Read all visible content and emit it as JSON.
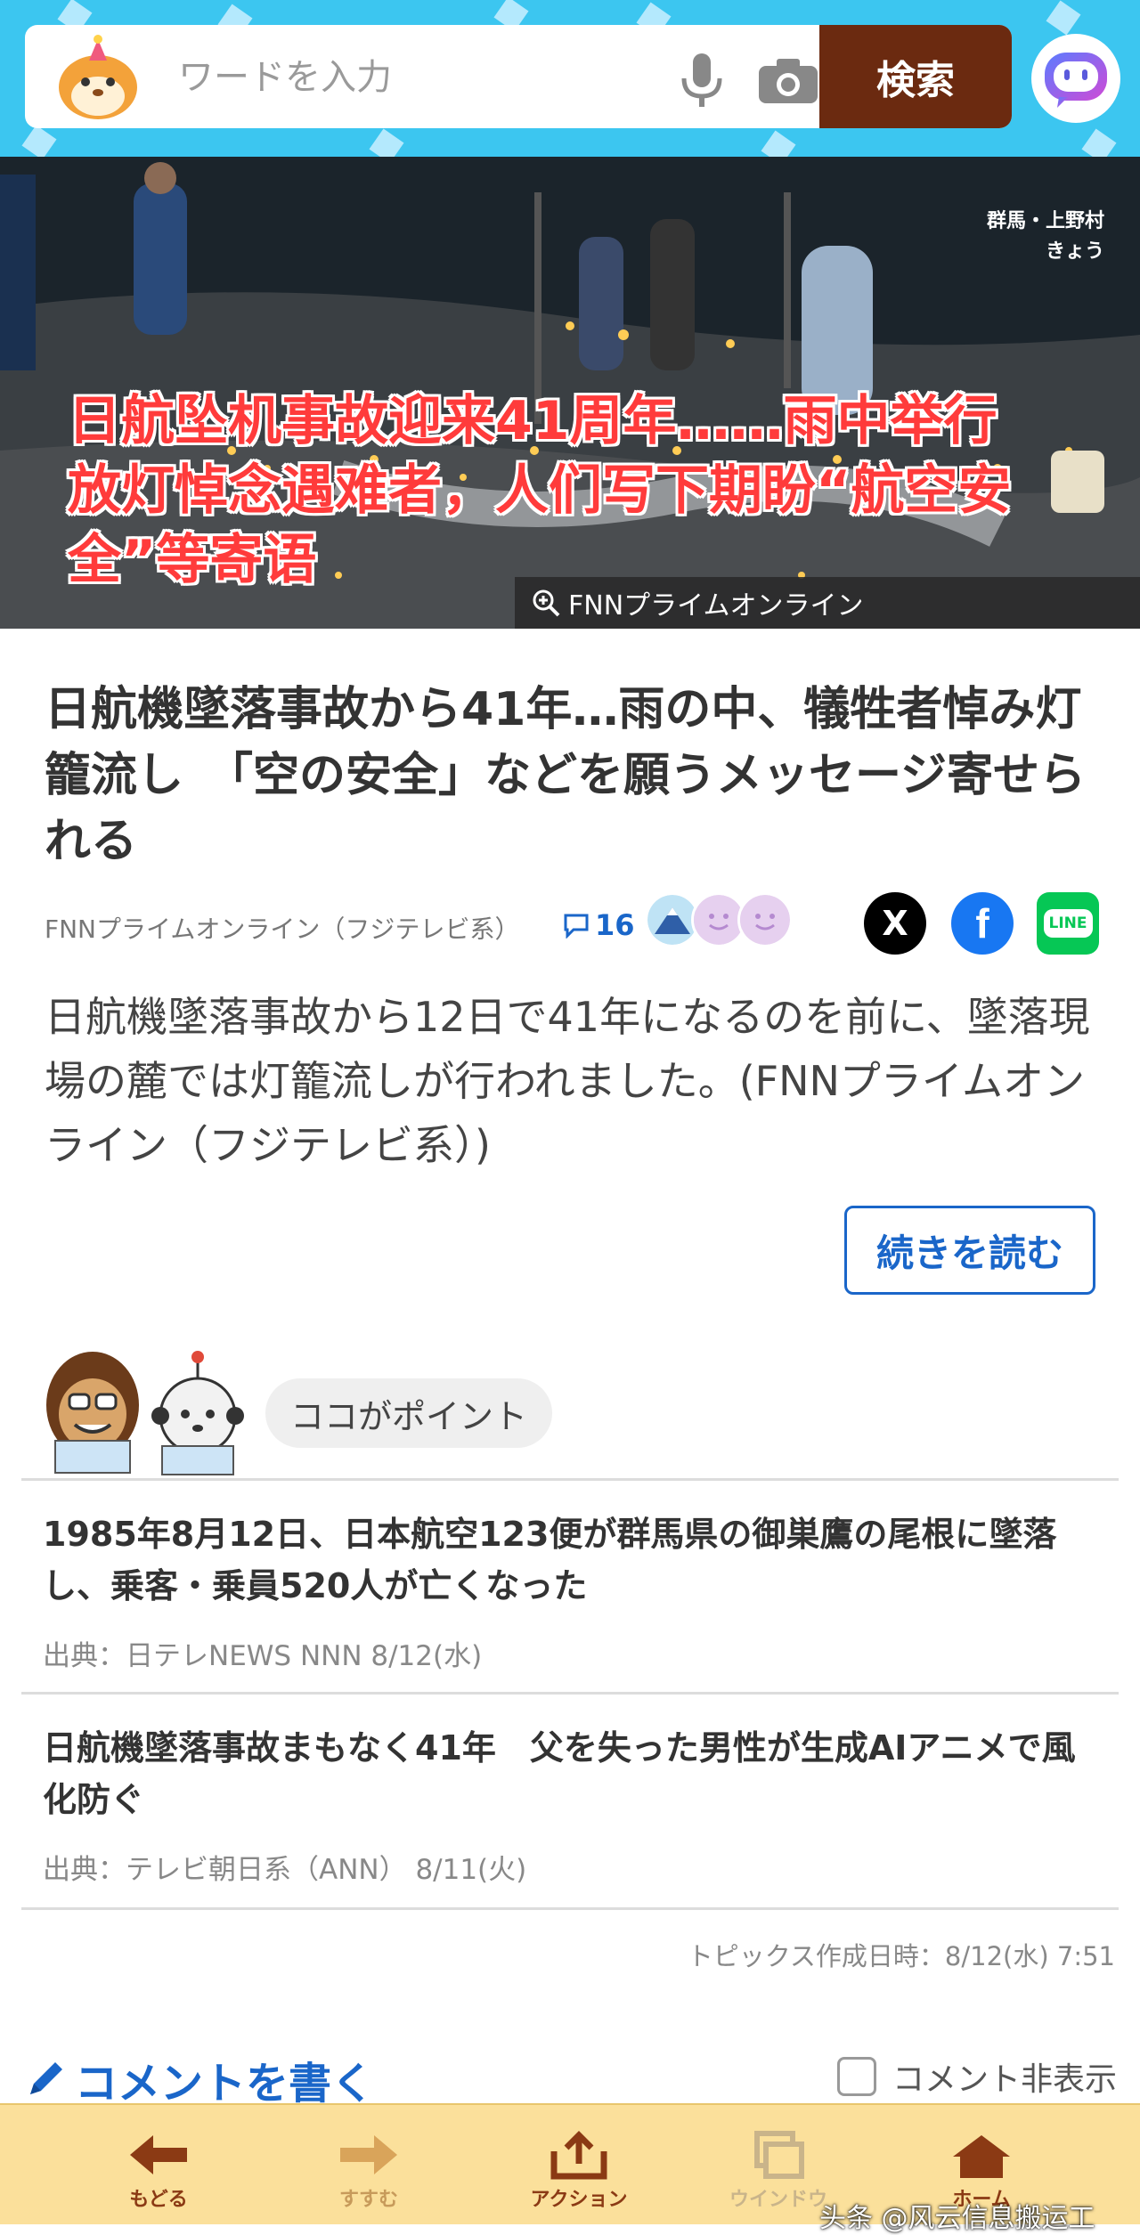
{
  "search": {
    "placeholder": "ワードを入力",
    "button_label": "検索"
  },
  "hero": {
    "location_line1": "群馬・上野村",
    "location_line2": "きょう",
    "caption": "日航坠机事故迎来41周年……雨中举行放灯悼念遇难者，人们写下期盼“航空安全”等寄语",
    "credit": "FNNプライムオンライン"
  },
  "article": {
    "title": "日航機墜落事故から41年…雨の中、犠牲者悼み灯籠流し　「空の安全」などを願うメッセージ寄せられる",
    "source": "FNNプライムオンライン（フジテレビ系）",
    "comment_count": "16",
    "share_x": "X",
    "share_facebook": "f",
    "share_line": "LINE",
    "summary": "日航機墜落事故から12日で41年になるのを前に、墜落現場の麓では灯籠流しが行われました。(FNNプライムオンライン（フジテレビ系）)",
    "read_more": "続きを読む"
  },
  "points": {
    "badge": "ココがポイント",
    "items": [
      {
        "headline": "1985年8月12日、日本航空123便が群馬県の御巣鷹の尾根に墜落し、乗客・乗員520人が亡くなった",
        "source": "出典：日テレNEWS NNN 8/12(水)"
      },
      {
        "headline": "日航機墜落事故まもなく41年　父を失った男性が生成AIアニメで風化防ぐ",
        "source": "出典：テレビ朝日系（ANN） 8/11(火)"
      }
    ],
    "topic_time": "トピックス作成日時：8/12(水) 7:51"
  },
  "comment_row": {
    "write": "コメントを書く",
    "hide": "コメント非表示"
  },
  "bottom_nav": {
    "back": "もどる",
    "forward": "すすむ",
    "action": "アクション",
    "window": "ウインドウ",
    "home": "ホーム"
  },
  "watermark": "头条 @风云信息搬运工",
  "colors": {
    "header_bg": "#3cc6f0",
    "search_button": "#6b2a10",
    "link_blue": "#1a66c9",
    "caption_red": "#ff3b3b",
    "bottom_bar": "#fbe09b"
  }
}
